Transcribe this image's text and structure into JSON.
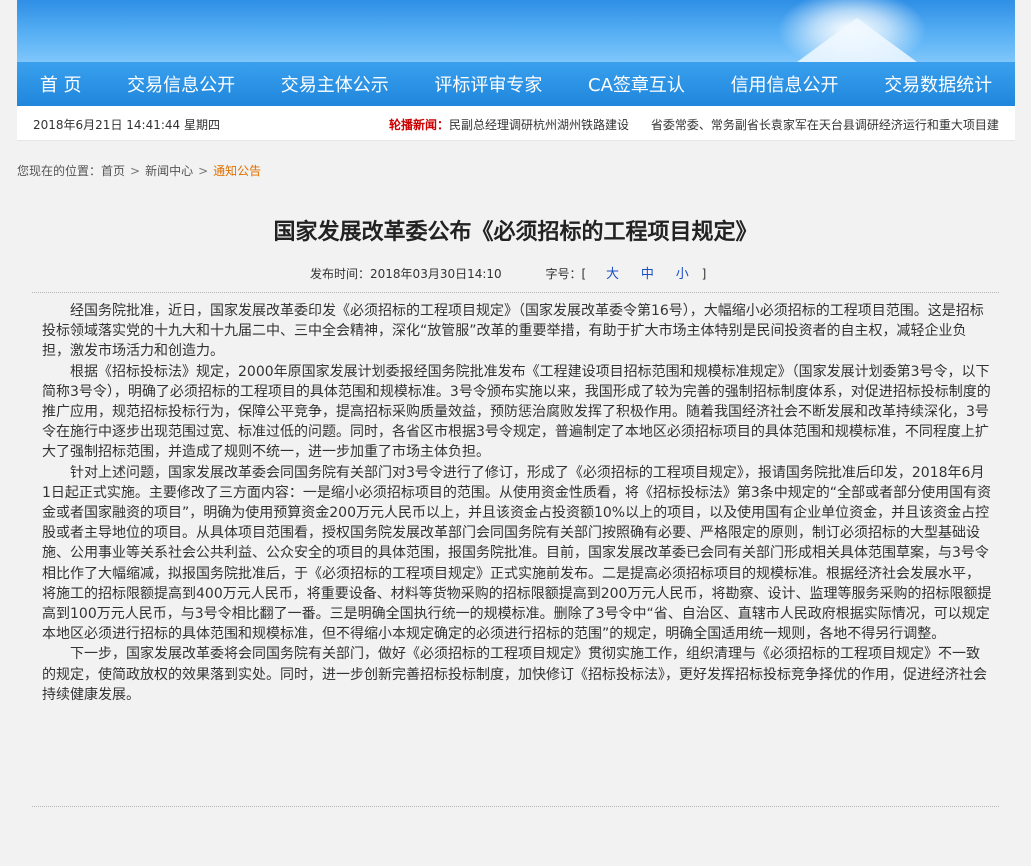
{
  "nav": {
    "items": [
      "首 页",
      "交易信息公开",
      "交易主体公示",
      "评标评审专家",
      "CA签章互认",
      "信用信息公开",
      "交易数据统计"
    ]
  },
  "infobar": {
    "datetime": "2018年6月21日 14:41:44 星期四",
    "scroll_label": "轮播新闻：",
    "scroll_items": [
      "民副总经理调研杭州湖州铁路建设",
      "省委常委、常务副省长袁家军在天台县调研经济运行和重大项目建设"
    ]
  },
  "breadcrumb": {
    "prefix": "您现在的位置：",
    "home": "首页",
    "news": "新闻中心",
    "current": "通知公告",
    "separator": ">"
  },
  "article": {
    "title": "国家发展改革委公布《必须招标的工程项目规定》",
    "publish_label": "发布时间：",
    "publish_time": "2018年03月30日14:10",
    "font_size_label": "字号：[",
    "font_size_end": "]",
    "size_large": "大",
    "size_medium": "中",
    "size_small": "小",
    "paragraphs": [
      "经国务院批准，近日，国家发展改革委印发《必须招标的工程项目规定》（国家发展改革委令第16号），大幅缩小必须招标的工程项目范围。这是招标投标领域落实党的十九大和十九届二中、三中全会精神，深化“放管服”改革的重要举措，有助于扩大市场主体特别是民间投资者的自主权，减轻企业负担，激发市场活力和创造力。",
      "根据《招标投标法》规定，2000年原国家发展计划委报经国务院批准发布《工程建设项目招标范围和规模标准规定》（国家发展计划委第3号令，以下简称3号令），明确了必须招标的工程项目的具体范围和规模标准。3号令颁布实施以来，我国形成了较为完善的强制招标制度体系，对促进招标投标制度的推广应用，规范招标投标行为，保障公平竞争，提高招标采购质量效益，预防惩治腐败发挥了积极作用。随着我国经济社会不断发展和改革持续深化，3号令在施行中逐步出现范围过宽、标准过低的问题。同时，各省区市根据3号令规定，普遍制定了本地区必须招标项目的具体范围和规模标准，不同程度上扩大了强制招标范围，并造成了规则不统一，进一步加重了市场主体负担。",
      "针对上述问题，国家发展改革委会同国务院有关部门对3号令进行了修订，形成了《必须招标的工程项目规定》，报请国务院批准后印发，2018年6月1日起正式实施。主要修改了三方面内容：一是缩小必须招标项目的范围。从使用资金性质看，将《招标投标法》第3条中规定的“全部或者部分使用国有资金或者国家融资的项目”，明确为使用预算资金200万元人民币以上，并且该资金占投资额10%以上的项目，以及使用国有企业单位资金，并且该资金占控股或者主导地位的项目。从具体项目范围看，授权国务院发展改革部门会同国务院有关部门按照确有必要、严格限定的原则，制订必须招标的大型基础设施、公用事业等关系社会公共利益、公众安全的项目的具体范围，报国务院批准。目前，国家发展改革委已会同有关部门形成相关具体范围草案，与3号令相比作了大幅缩减，拟报国务院批准后，于《必须招标的工程项目规定》正式实施前发布。二是提高必须招标项目的规模标准。根据经济社会发展水平，将施工的招标限额提高到400万元人民币，将重要设备、材料等货物采购的招标限额提高到200万元人民币，将勘察、设计、监理等服务采购的招标限额提高到100万元人民币，与3号令相比翻了一番。三是明确全国执行统一的规模标准。删除了3号令中“省、自治区、直辖市人民政府根据实际情况，可以规定本地区必须进行招标的具体范围和规模标准，但不得缩小本规定确定的必须进行招标的范围”的规定，明确全国适用统一规则，各地不得另行调整。",
      "下一步，国家发展改革委将会同国务院有关部门，做好《必须招标的工程项目规定》贯彻实施工作，组织清理与《必须招标的工程项目规定》不一致的规定，使简政放权的效果落到实处。同时，进一步创新完善招标投标制度，加快修订《招标投标法》，更好发挥招标投标竞争择优的作用，促进经济社会持续健康发展。"
    ]
  }
}
